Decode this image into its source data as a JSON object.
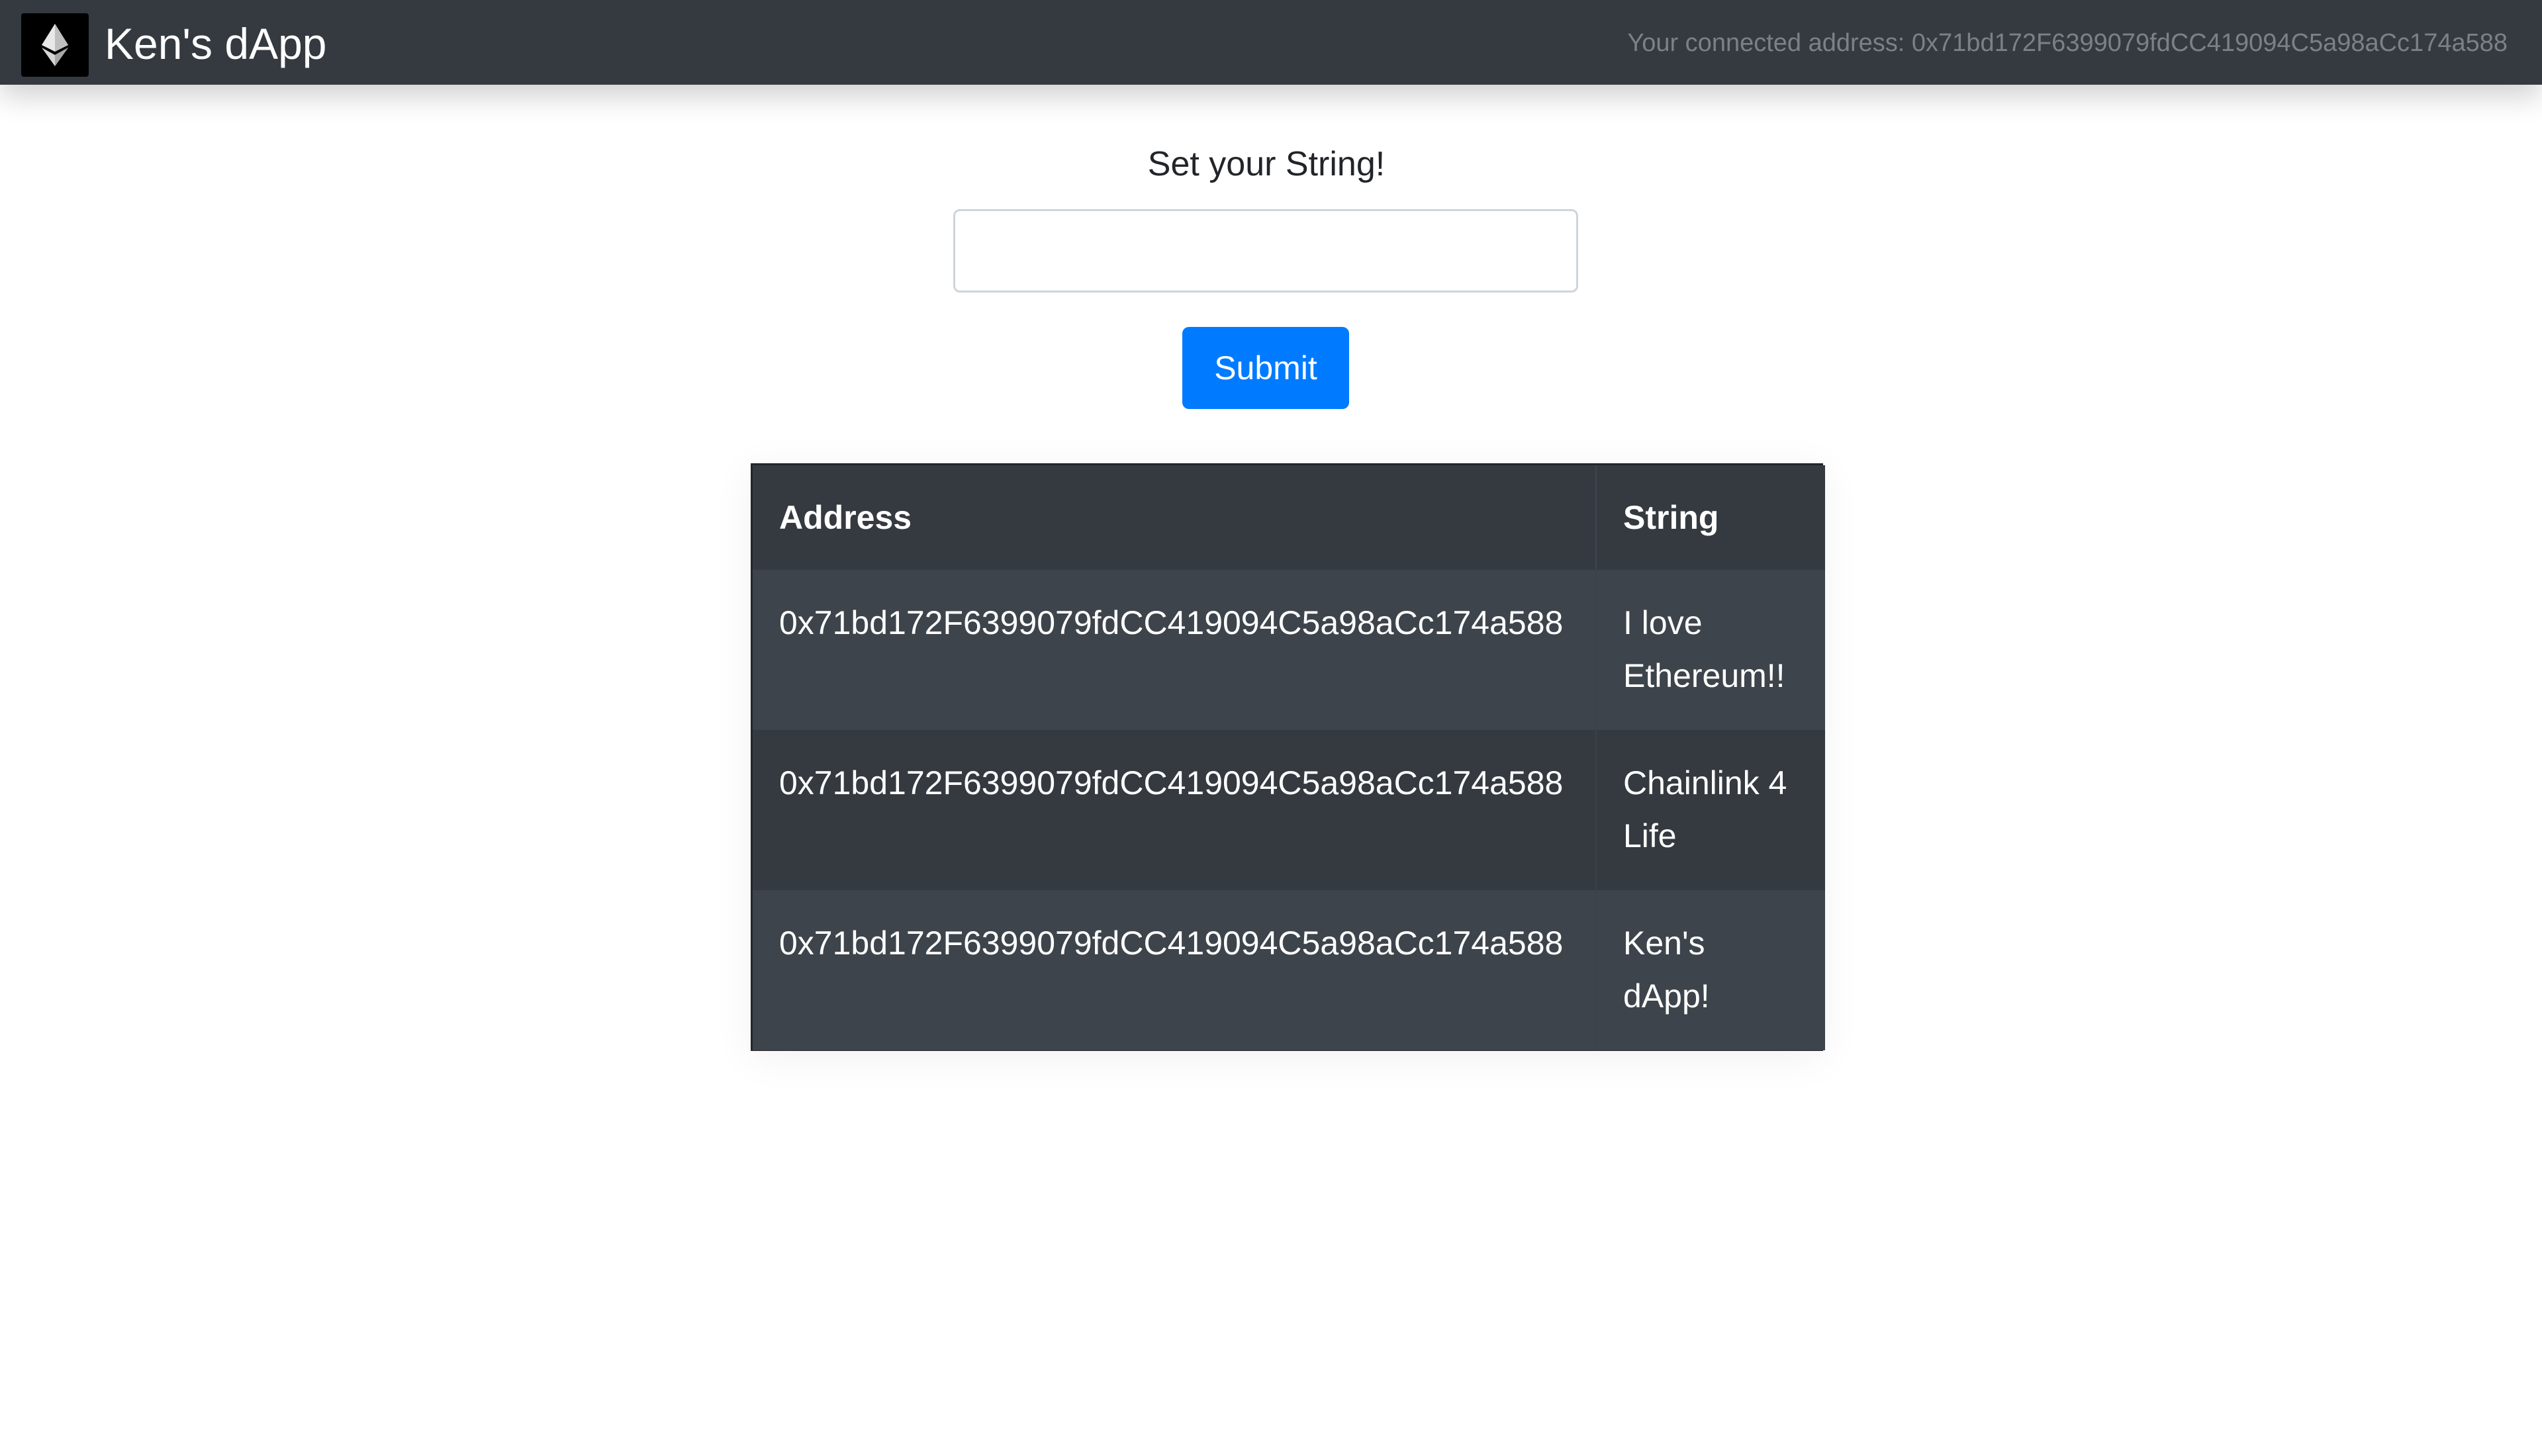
{
  "navbar": {
    "logo_icon": "ethereum-icon",
    "title": "Ken's dApp",
    "connected_text": "Your connected address: 0x71bd172F6399079fdCC419094C5a98aCc174a588"
  },
  "form": {
    "label": "Set your String!",
    "input_value": "",
    "input_placeholder": "",
    "submit_label": "Submit",
    "submit_color": "#007bff"
  },
  "table": {
    "headers": [
      "Address",
      "String"
    ],
    "rows": [
      {
        "address": "0x71bd172F6399079fdCC419094C5a98aCc174a588",
        "string": "I love Ethereum!!"
      },
      {
        "address": "0x71bd172F6399079fdCC419094C5a98aCc174a588",
        "string": "Chainlink 4 Life"
      },
      {
        "address": "0x71bd172F6399079fdCC419094C5a98aCc174a588",
        "string": "Ken's dApp!"
      }
    ]
  },
  "colors": {
    "navbar_bg": "#343a40",
    "table_bg": "#343a40",
    "table_row_alt": "#3e444b",
    "accent": "#007bff"
  }
}
